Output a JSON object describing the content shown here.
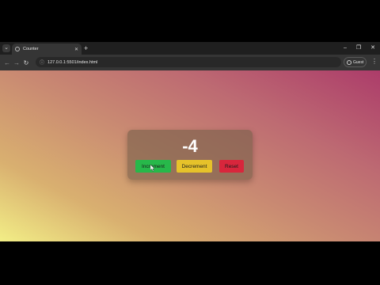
{
  "browser": {
    "tab": {
      "title": "Counter"
    },
    "url": "127.0.0.1:5501/index.html",
    "guest_label": "Guest"
  },
  "counter": {
    "value": "-4",
    "buttons": {
      "increment": "Increment",
      "decrement": "Decrement",
      "reset": "Reset"
    }
  },
  "colors": {
    "increment": "#27b84a",
    "decrement": "#e6c22a",
    "reset": "#d8263c"
  },
  "icons": [
    "chevron-down-icon",
    "globe-icon",
    "close-icon",
    "plus-icon",
    "minimize-icon",
    "maximize-icon",
    "back-arrow-icon",
    "forward-arrow-icon",
    "reload-icon",
    "site-info-icon",
    "guest-profile-icon",
    "kebab-menu-icon",
    "mouse-cursor-icon"
  ]
}
